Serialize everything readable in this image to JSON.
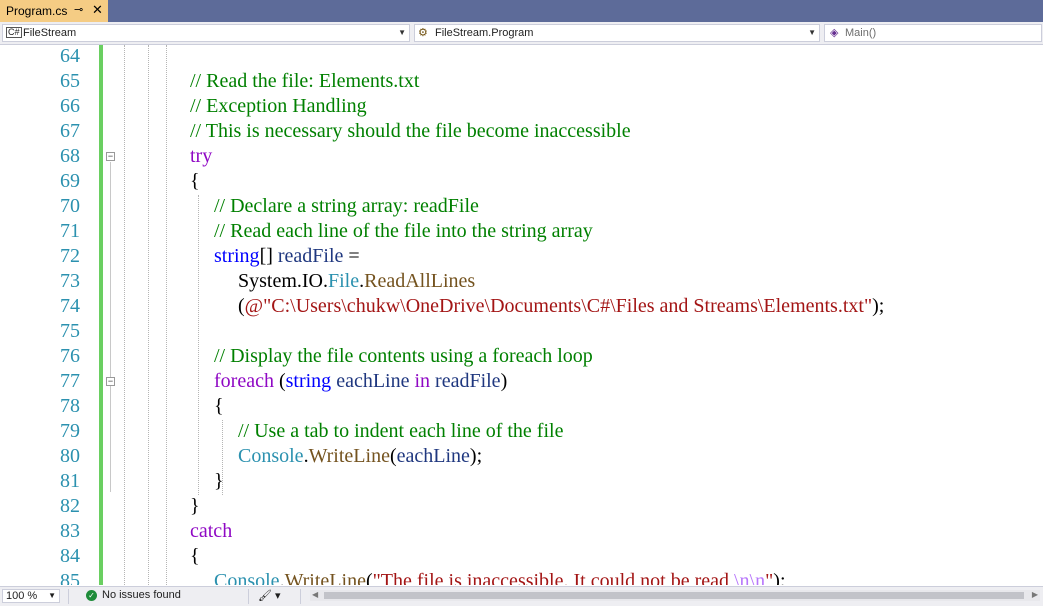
{
  "tab": {
    "title": "Program.cs",
    "pin": "⊸",
    "close": "✕"
  },
  "nav": {
    "project": "FileStream",
    "project_icon": "C#",
    "class": "FileStream.Program",
    "member": "Main()"
  },
  "editor": {
    "lines": [
      {
        "n": "64"
      },
      {
        "n": "65"
      },
      {
        "n": "66"
      },
      {
        "n": "67"
      },
      {
        "n": "68"
      },
      {
        "n": "69"
      },
      {
        "n": "70"
      },
      {
        "n": "71"
      },
      {
        "n": "72"
      },
      {
        "n": "73"
      },
      {
        "n": "74"
      },
      {
        "n": "75"
      },
      {
        "n": "76"
      },
      {
        "n": "77"
      },
      {
        "n": "78"
      },
      {
        "n": "79"
      },
      {
        "n": "80"
      },
      {
        "n": "81"
      },
      {
        "n": "82"
      },
      {
        "n": "83"
      },
      {
        "n": "84"
      },
      {
        "n": "85"
      }
    ],
    "code": {
      "c65": "// Read the file: Elements.txt",
      "c66": "// Exception Handling",
      "c67": "// This is necessary should the file become inaccessible",
      "c68": "try",
      "c69": "{",
      "c70": "// Declare a string array: readFile",
      "c71": "// Read each line of the file into the string array",
      "c72_kw": "string",
      "c72_rest": "[] ",
      "c72_id": "readFile",
      "c72_eq": " =",
      "c73_ns": "System.IO.",
      "c73_ty": "File",
      "c73_dot": ".",
      "c73_mt": "ReadAllLines",
      "c74_open": "(",
      "c74_str": "@\"C:\\Users\\chukw\\OneDrive\\Documents\\C#\\Files and Streams\\Elements.txt\"",
      "c74_close": ");",
      "c76": "// Display the file contents using a foreach loop",
      "c77_kw": "foreach",
      "c77_p": " (",
      "c77_ty": "string",
      "c77_sp": " ",
      "c77_id": "eachLine",
      "c77_in": " in ",
      "c77_id2": "readFile",
      "c77_close": ")",
      "c78": "{",
      "c79": "// Use a tab to indent each line of the file",
      "c80_ty": "Console",
      "c80_dot": ".",
      "c80_mt": "WriteLine",
      "c80_open": "(",
      "c80_id": "eachLine",
      "c80_close": ");",
      "c81": "}",
      "c82": "}",
      "c83": "catch",
      "c84": "{",
      "c85_ty": "Console",
      "c85_dot": ".",
      "c85_mt": "WriteLine",
      "c85_open": "(",
      "c85_str": "\"The file is inaccessible. It could not be read ",
      "c85_esc": "\\n\\n",
      "c85_strend": "\"",
      "c85_close": ");"
    }
  },
  "status": {
    "zoom": "100 %",
    "issues": "No issues found",
    "issues_icon": "✓",
    "brush_icon": "🖌"
  }
}
